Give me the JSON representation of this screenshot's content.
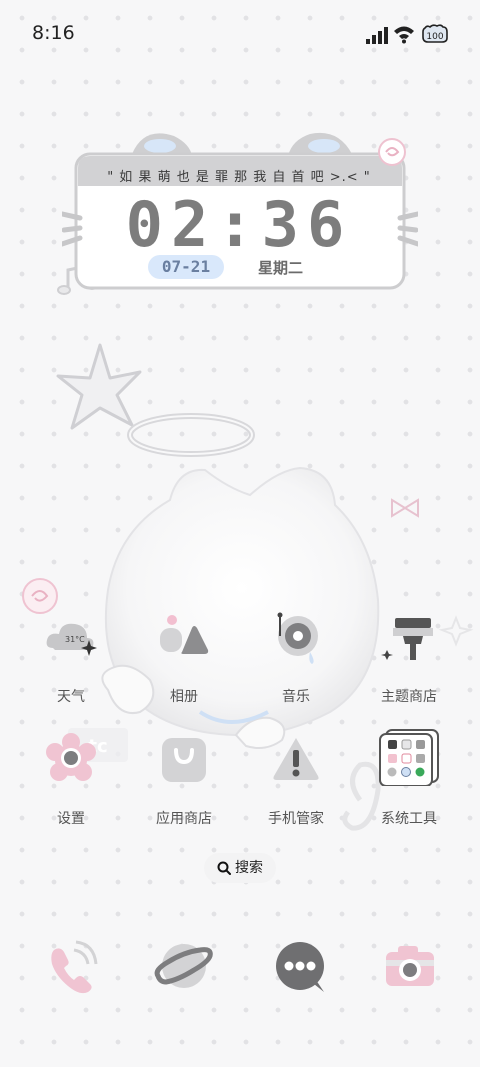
{
  "status_bar": {
    "time": "8:16",
    "battery": "100"
  },
  "widget": {
    "quote": "\" 如 果 萌 也 是 罪   那 我 自 首 吧  >.< \"",
    "time": "02:36",
    "date": "07-21",
    "weekday": "星期二"
  },
  "apps": [
    {
      "label": "天气",
      "icon": "weather-icon",
      "temp": "31°C"
    },
    {
      "label": "相册",
      "icon": "gallery-icon"
    },
    {
      "label": "音乐",
      "icon": "music-icon"
    },
    {
      "label": "主题商店",
      "icon": "theme-store-icon"
    },
    {
      "label": "设置",
      "icon": "settings-icon"
    },
    {
      "label": "应用商店",
      "icon": "app-store-icon"
    },
    {
      "label": "手机管家",
      "icon": "phone-manager-icon"
    },
    {
      "label": "系统工具",
      "icon": "system-tools-folder-icon"
    }
  ],
  "search": {
    "label": "搜索"
  },
  "dock": [
    "phone-icon",
    "browser-icon",
    "messages-icon",
    "camera-icon"
  ],
  "colors": {
    "pink": "#f0c4d2",
    "blue_pill": "#d9e8fb",
    "gray": "#7d7d7d"
  }
}
